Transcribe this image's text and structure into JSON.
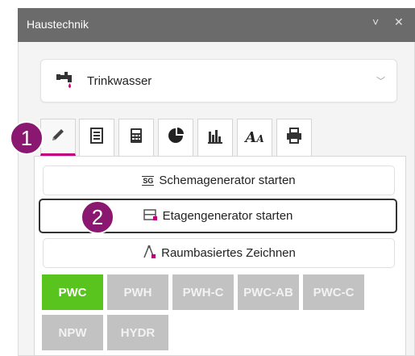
{
  "window": {
    "title": "Haustechnik",
    "minimize_glyph": "˅",
    "close_glyph": "✕"
  },
  "medium": {
    "selected": "Trinkwasser",
    "icon": "faucet-icon"
  },
  "tabs": [
    {
      "icon": "pencil-icon",
      "active": true
    },
    {
      "icon": "list-document-icon"
    },
    {
      "icon": "calculator-icon"
    },
    {
      "icon": "pie-chart-icon"
    },
    {
      "icon": "bar-chart-icon"
    },
    {
      "icon": "text-style-icon"
    },
    {
      "icon": "printer-icon"
    }
  ],
  "actions": {
    "schema": "Schemagenerator starten",
    "schema_icon_text": "SG",
    "floor": "Etagengenerator starten",
    "room": "Raumbasiertes Zeichnen"
  },
  "systems": {
    "row1": [
      "PWC",
      "PWH",
      "PWH-C",
      "PWC-AB",
      "PWC-C"
    ],
    "row2": [
      "NPW",
      "HYDR"
    ],
    "active": "PWC"
  },
  "badges": [
    "1",
    "2"
  ],
  "colors": {
    "accent": "#c0007a",
    "badge": "#8a1770",
    "active_chip": "#5ac41e",
    "inactive_chip": "#c2c2c2",
    "titlebar": "#6b6b6b"
  }
}
